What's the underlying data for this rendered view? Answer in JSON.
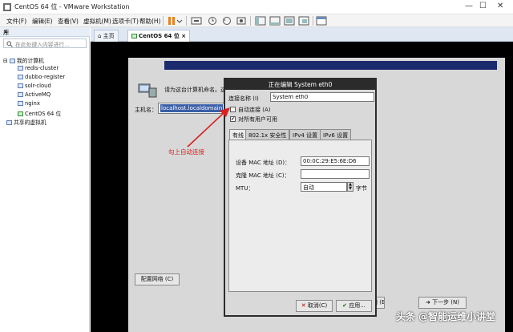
{
  "window": {
    "title": "CentOS 64 位 - VMware Workstation",
    "minimize": "—",
    "maximize": "☐",
    "close": "✕"
  },
  "menu": [
    "文件(F)",
    "编辑(E)",
    "查看(V)",
    "虚拟机(M)",
    "选项卡(T)",
    "帮助(H)"
  ],
  "library": {
    "title": "库",
    "close": "×",
    "search_placeholder": "在此处键入内容进行...",
    "root": "我的计算机",
    "vms": [
      "redis-cluster",
      "dubbo-register",
      "solr-cloud",
      "ActiveMQ",
      "nginx",
      "CentOS 64 位"
    ],
    "shared": "共享的虚拟机"
  },
  "tabs": [
    {
      "label": "主页"
    },
    {
      "label": "CentOS 64 位",
      "close": "×"
    }
  ],
  "installer": {
    "question": "请为这台计算机命名。这",
    "hostname_label": "主机名：",
    "hostname_value": "localhost.localdomain",
    "configure_network": "配置网络 (C)",
    "back": "返回 (B)",
    "next": "下一步 (N)"
  },
  "dialog": {
    "title": "正在编辑 System eth0",
    "name_label": "连接名称 (I)",
    "name_value": "System eth0",
    "auto_connect": "自动连接 (A)",
    "auto_connect_checked": false,
    "all_users": "对所有用户可用",
    "all_users_checked": true,
    "tabs": [
      "有线",
      "802.1x 安全性",
      "IPv4 设置",
      "IPv6 设置"
    ],
    "device_mac_label": "设备 MAC 地址 (D)：",
    "device_mac_value": "00:0C:29:E5:6E:D6",
    "clone_mac_label": "克隆 MAC 地址 (C)：",
    "clone_mac_value": "",
    "mtu_label": "MTU：",
    "mtu_value": "自动",
    "mtu_unit": "字节",
    "cancel": "取消(C)",
    "apply": "应用..."
  },
  "annotation": "勾上自动连接",
  "watermark": "头条 @智能运维小讲堂",
  "colors": {
    "annotation": "#d9201d",
    "banner": "#1c2a6e",
    "dialog_title": "#2b2b2b"
  }
}
